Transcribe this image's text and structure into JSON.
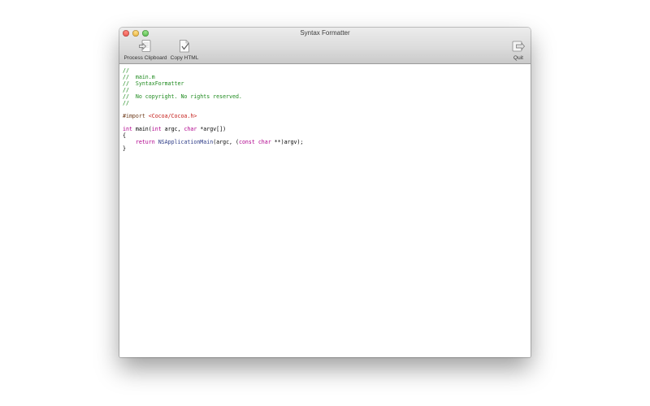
{
  "window": {
    "title": "Syntax Formatter"
  },
  "toolbar": {
    "process_label": "Process Clipboard",
    "copy_label": "Copy HTML",
    "quit_label": "Quit"
  },
  "icons": {
    "process": "paste-into-document-icon",
    "copy": "copy-html-document-icon",
    "quit": "quit-door-icon"
  },
  "colors": {
    "comment": "#1e8a1e",
    "keyword": "#b0008c",
    "string": "#c41a16",
    "preprocessor": "#6e3c1c",
    "function": "#2b3a86"
  },
  "code": [
    [
      {
        "t": "//",
        "c": "comment"
      }
    ],
    [
      {
        "t": "//  main.m",
        "c": "comment"
      }
    ],
    [
      {
        "t": "//  SyntaxFormatter",
        "c": "comment"
      }
    ],
    [
      {
        "t": "//",
        "c": "comment"
      }
    ],
    [
      {
        "t": "//  No copyright. No rights reserved.",
        "c": "comment"
      }
    ],
    [
      {
        "t": "//",
        "c": "comment"
      }
    ],
    [],
    [
      {
        "t": "#import ",
        "c": "preprocessor"
      },
      {
        "t": "<Cocoa/Cocoa.h>",
        "c": "string"
      }
    ],
    [],
    [
      {
        "t": "int",
        "c": "keyword"
      },
      {
        "t": " main(",
        "c": ""
      },
      {
        "t": "int",
        "c": "keyword"
      },
      {
        "t": " argc, ",
        "c": ""
      },
      {
        "t": "char",
        "c": "keyword"
      },
      {
        "t": " *argv[])",
        "c": ""
      }
    ],
    [
      {
        "t": "{",
        "c": ""
      }
    ],
    [
      {
        "t": "    ",
        "c": ""
      },
      {
        "t": "return",
        "c": "keyword"
      },
      {
        "t": " ",
        "c": ""
      },
      {
        "t": "NSApplicationMain",
        "c": "function"
      },
      {
        "t": "(argc, (",
        "c": ""
      },
      {
        "t": "const",
        "c": "keyword"
      },
      {
        "t": " ",
        "c": ""
      },
      {
        "t": "char",
        "c": "keyword"
      },
      {
        "t": " **)argv);",
        "c": ""
      }
    ],
    [
      {
        "t": "}",
        "c": ""
      }
    ]
  ]
}
